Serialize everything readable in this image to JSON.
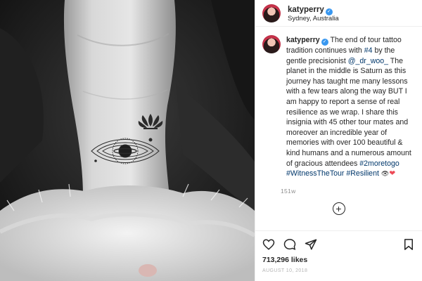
{
  "post": {
    "username": "katyperry",
    "verified_mark": "✓",
    "location": "Sydney, Australia",
    "caption": {
      "username": "katyperry",
      "verified_mark": "✓",
      "part1": "The end of tour tattoo tradition continues with ",
      "hashtag_4": "#4",
      "part2": " by the gentle precisionist ",
      "mention": "@_dr_woo_",
      "part3": " The planet in the middle is Saturn as this journey has taught me many lessons with a few tears along the way BUT I am happy to report a sense of real resilience as we wrap. I share this insignia with 45 other tour mates and moreover an incredible year of memories with over 100 beautiful & kind humans and a numerous amount of gracious attendees ",
      "hashtag_2moretogo": "#2moretogo",
      "hashtag_witness": "#WitnessTheTour",
      "hashtag_resilient": "#Resilient",
      "eye_emoji": "👁",
      "heart_emoji": "❤"
    },
    "time_ago": "151w",
    "add_comment_symbol": "+",
    "likes": "713,296 likes",
    "date": "AUGUST 10, 2018"
  },
  "icons": {
    "like": "heart-outline-icon",
    "comment": "comment-bubble-icon",
    "share": "paper-plane-icon",
    "save": "bookmark-icon",
    "add_comment": "plus-circle-icon",
    "verified": "verified-badge-icon"
  },
  "colors": {
    "link": "#00376b",
    "verified": "#3897f0",
    "heart": "#ed4956",
    "muted": "#8e8e8e"
  }
}
